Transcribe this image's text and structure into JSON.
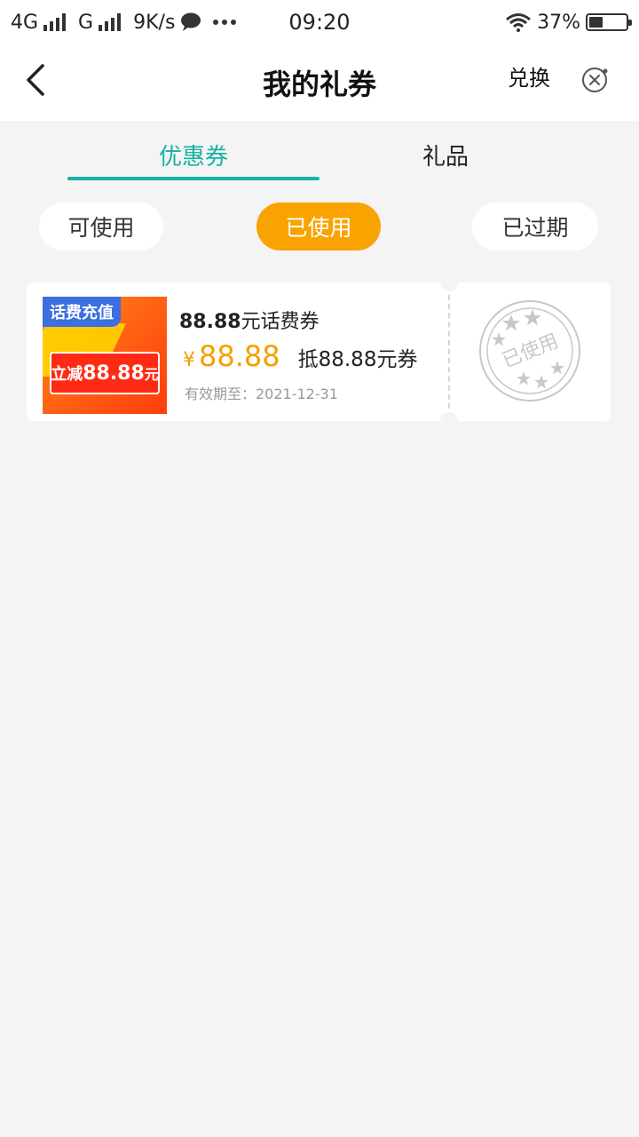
{
  "status_bar": {
    "network1": "4G",
    "network2": "G",
    "speed": "9K/s",
    "time": "09:20",
    "battery_percent": "37%",
    "battery_level": 0.37
  },
  "header": {
    "title": "我的礼券",
    "exchange_label": "兑换"
  },
  "tabs": [
    {
      "label": "优惠券",
      "active": true
    },
    {
      "label": "礼品",
      "active": false
    }
  ],
  "filters": [
    {
      "label": "可使用",
      "active": false
    },
    {
      "label": "已使用",
      "active": true
    },
    {
      "label": "已过期",
      "active": false
    }
  ],
  "coupons": [
    {
      "image_tag": "话费充值",
      "image_badge_prefix": "立减",
      "image_badge_amount": "88.88",
      "image_badge_suffix": "元",
      "name_amount": "88.88",
      "name_suffix": "元话费券",
      "currency": "¥",
      "amount": "88.88",
      "deduct_text": "抵88.88元券",
      "expiry": "有效期至：2021-12-31",
      "stamp_text": "已使用"
    }
  ],
  "colors": {
    "accent_teal": "#17b3a3",
    "accent_orange": "#f9a300",
    "price_orange": "#f5a000",
    "background": "#f4f4f4"
  }
}
